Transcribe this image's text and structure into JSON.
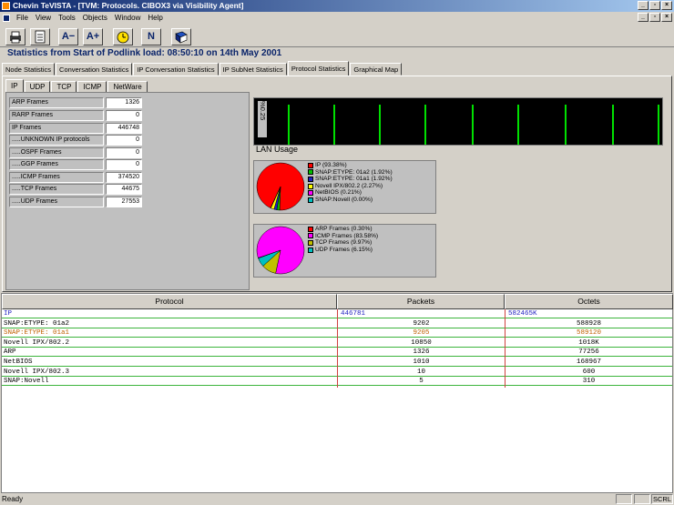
{
  "window": {
    "title": "Chevin TeVISTA - [TVM: Protocols.  CIBOX3 via Visibility Agent]"
  },
  "menu": [
    "File",
    "View",
    "Tools",
    "Objects",
    "Window",
    "Help"
  ],
  "toolbar": {
    "font_decrease": "A−",
    "font_increase": "A+",
    "n_label": "N"
  },
  "headline": "Statistics from Start of Podlink load: 08:50:10 on 14th May 2001",
  "tabs": [
    "Node Statistics",
    "Conversation Statistics",
    "IP Conversation Statistics",
    "IP SubNet Statistics",
    "Protocol Statistics",
    "Graphical Map"
  ],
  "subtabs": [
    "IP",
    "UDP",
    "TCP",
    "ICMP",
    "NetWare"
  ],
  "stats": [
    {
      "label": "ARP Frames",
      "value": "1326"
    },
    {
      "label": "RARP Frames",
      "value": "0"
    },
    {
      "label": "IP Frames",
      "value": "446748"
    },
    {
      "label": ".....UNKNOWN IP protocols",
      "value": "0"
    },
    {
      "label": ".....OSPF Frames",
      "value": "0"
    },
    {
      "label": ".....GGP Frames",
      "value": "0"
    },
    {
      "label": ".....ICMP Frames",
      "value": "374520"
    },
    {
      "label": ".....TCP Frames",
      "value": "44675"
    },
    {
      "label": ".....UDP Frames",
      "value": "27553"
    }
  ],
  "lan": {
    "ylabel": "%0.25",
    "label": "LAN Usage",
    "color": "#00e000"
  },
  "pie1": [
    {
      "label": "IP (93.38%)",
      "pct": 93.38,
      "color": "#ff0000"
    },
    {
      "label": "SNAP:ETYPE: 01a2 (1.92%)",
      "pct": 1.92,
      "color": "#00c000"
    },
    {
      "label": "SNAP:ETYPE: 01a1 (1.92%)",
      "pct": 1.92,
      "color": "#2020c0"
    },
    {
      "label": "Novell IPX/802.2 (2.27%)",
      "pct": 2.27,
      "color": "#ffff00"
    },
    {
      "label": "NetBIOS (0.21%)",
      "pct": 0.21,
      "color": "#ff00ff"
    },
    {
      "label": "SNAP:Novell (0.00%)",
      "pct": 0.0,
      "color": "#00c0c0"
    }
  ],
  "pie2": [
    {
      "label": "ARP Frames (0.30%)",
      "pct": 0.3,
      "color": "#ff0000"
    },
    {
      "label": "ICMP Frames (83.58%)",
      "pct": 83.58,
      "color": "#ff00ff"
    },
    {
      "label": "TCP Frames (9.97%)",
      "pct": 9.97,
      "color": "#c0c000"
    },
    {
      "label": "UDP Frames (6.15%)",
      "pct": 6.15,
      "color": "#00c0c0"
    }
  ],
  "grid": {
    "headers": [
      "Protocol",
      "Packets",
      "Octets"
    ],
    "rows": [
      {
        "protocol": "IP",
        "packets": "446781",
        "octets": "582465K",
        "color": "#2020c0"
      },
      {
        "protocol": "SNAP:ETYPE: 01a2",
        "packets": "9202",
        "octets": "588928",
        "color": "#000000"
      },
      {
        "protocol": "SNAP:ETYPE: 01a1",
        "packets": "9205",
        "octets": "589120",
        "color": "#c06000"
      },
      {
        "protocol": "Novell IPX/802.2",
        "packets": "10850",
        "octets": "1018K",
        "color": "#000000"
      },
      {
        "protocol": "ARP",
        "packets": "1326",
        "octets": "77256",
        "color": "#000000"
      },
      {
        "protocol": "NetBIOS",
        "packets": "1010",
        "octets": "168967",
        "color": "#000000"
      },
      {
        "protocol": "Novell IPX/802.3",
        "packets": "10",
        "octets": "600",
        "color": "#000000"
      },
      {
        "protocol": "SNAP:Novell",
        "packets": "5",
        "octets": "310",
        "color": "#000000"
      }
    ]
  },
  "status": {
    "left": "Ready",
    "right": "SCRL"
  }
}
